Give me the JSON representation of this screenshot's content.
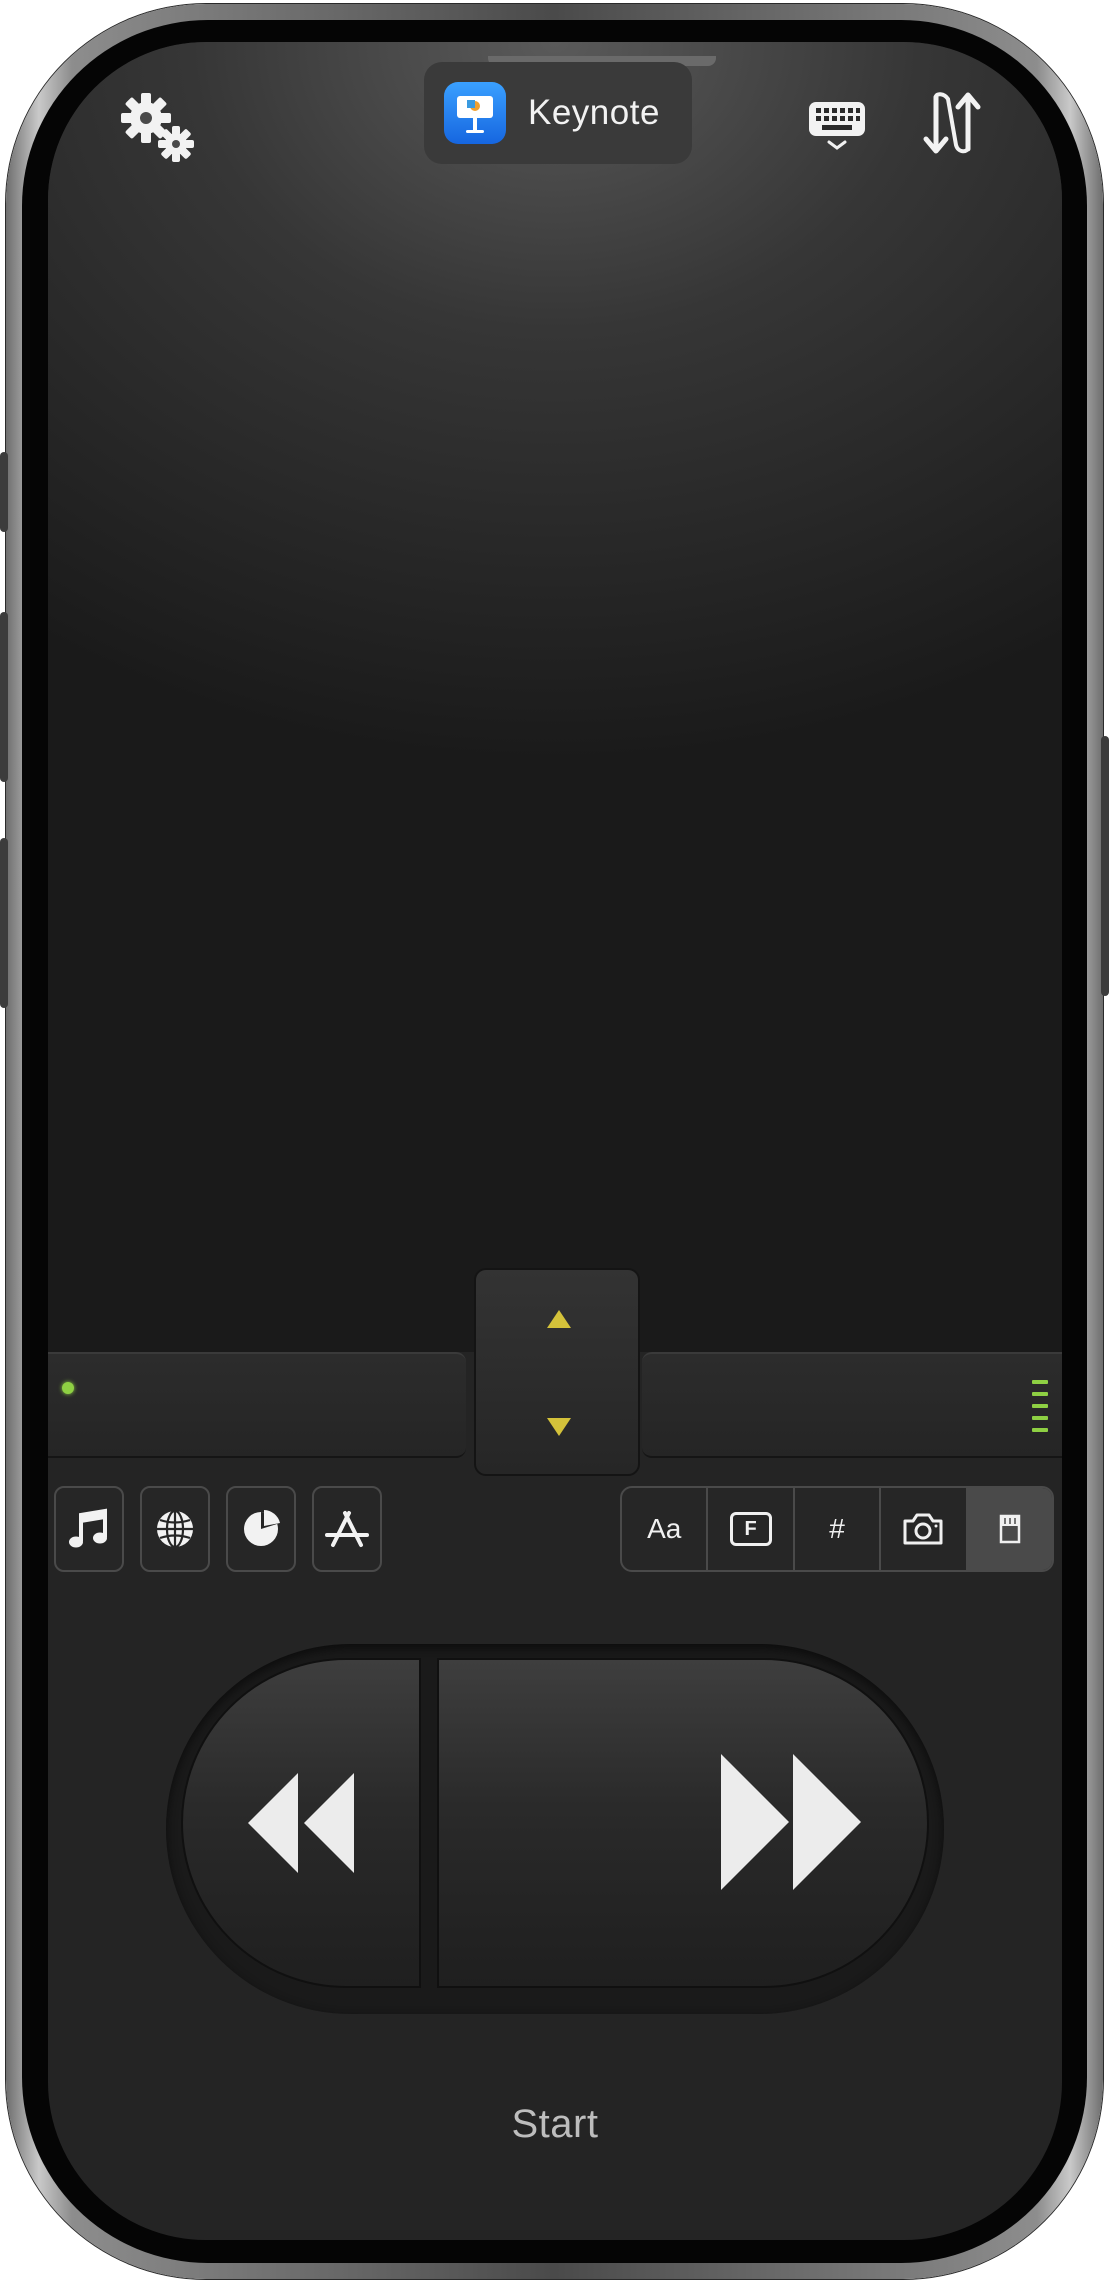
{
  "app": {
    "name": "Keynote"
  },
  "header": {
    "settings_icon": "gears-icon",
    "keyboard_icon": "keyboard-icon",
    "swap_icon": "swap-arrows-icon"
  },
  "toolbar_left": [
    {
      "icon": "music-note-icon"
    },
    {
      "icon": "globe-icon"
    },
    {
      "icon": "pie-chart-icon"
    },
    {
      "icon": "app-store-icon"
    }
  ],
  "toolbar_right": [
    {
      "label": "Aa",
      "icon": "text-icon"
    },
    {
      "label": "F",
      "icon": "function-key-icon"
    },
    {
      "label": "#",
      "icon": "number-icon"
    },
    {
      "icon": "camera-icon"
    },
    {
      "icon": "presenter-notes-icon",
      "selected": true
    }
  ],
  "nav": {
    "prev_icon": "rewind-icon",
    "next_icon": "fast-forward-icon"
  },
  "footer": {
    "label": "Start"
  },
  "colors": {
    "accent_yellow": "#d4c23a",
    "status_green": "#8ed043",
    "keynote_blue": "#1666e0"
  }
}
